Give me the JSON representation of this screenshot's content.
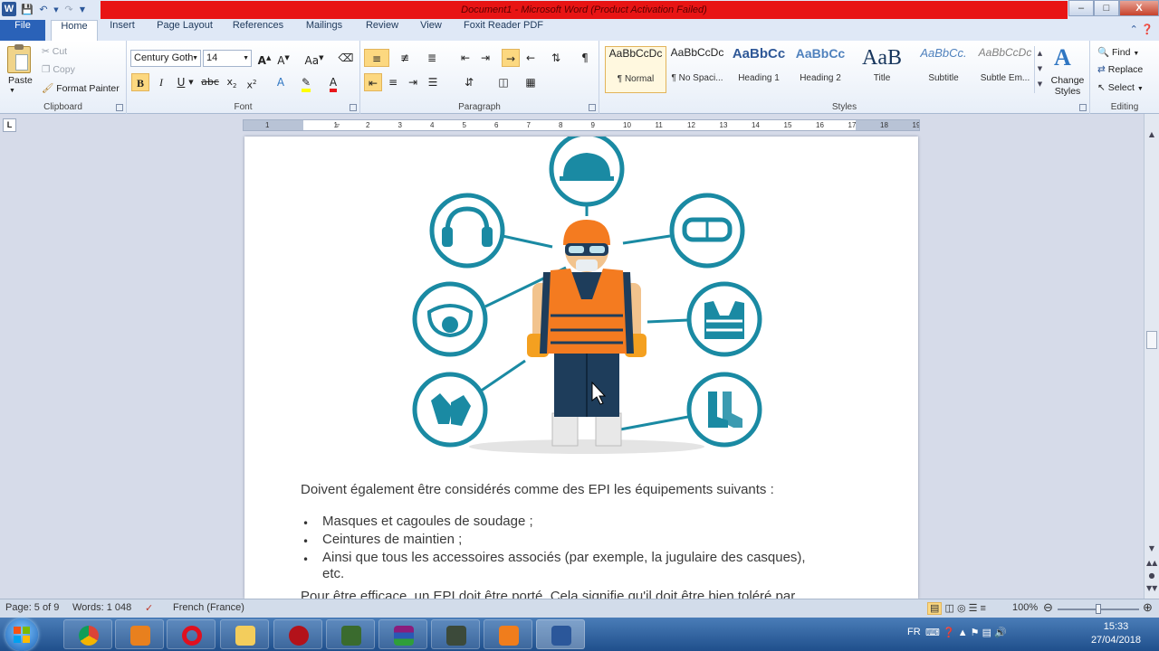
{
  "window": {
    "app_letter": "W",
    "title": "Document1  -  Microsoft Word (Product Activation Failed)",
    "min": "–",
    "max": "□",
    "close": "X"
  },
  "tabs": [
    "File",
    "Home",
    "Insert",
    "Page Layout",
    "References",
    "Mailings",
    "Review",
    "View",
    "Foxit Reader PDF"
  ],
  "clipboard": {
    "paste": "Paste",
    "cut": "Cut",
    "copy": "Copy",
    "format_painter": "Format Painter",
    "label": "Clipboard"
  },
  "font": {
    "name": "Century Goth",
    "size": "14",
    "label": "Font"
  },
  "paragraph": {
    "label": "Paragraph"
  },
  "styles": {
    "items": [
      {
        "preview": "AaBbCcDc",
        "name": "¶ Normal"
      },
      {
        "preview": "AaBbCcDc",
        "name": "¶ No Spaci..."
      },
      {
        "preview": "AaBbCc",
        "name": "Heading 1"
      },
      {
        "preview": "AaBbCc",
        "name": "Heading 2"
      },
      {
        "preview": "AaB",
        "name": "Title"
      },
      {
        "preview": "AaBbCc.",
        "name": "Subtitle"
      },
      {
        "preview": "AaBbCcDc",
        "name": "Subtle Em..."
      }
    ],
    "change_styles": "Change Styles",
    "label": "Styles"
  },
  "editing": {
    "find": "Find",
    "replace": "Replace",
    "select": "Select",
    "label": "Editing"
  },
  "ruler_numbers": [
    "1",
    "1",
    "2",
    "3",
    "4",
    "5",
    "6",
    "7",
    "8",
    "9",
    "10",
    "11",
    "12",
    "13",
    "14",
    "15",
    "16",
    "17",
    "18",
    "19"
  ],
  "document": {
    "intro": "Doivent également être considérés comme des EPI les équipements suivants :",
    "bullets": [
      "Masques et cagoules de soudage ;",
      "Ceintures de maintien ;",
      "Ainsi que tous les accessoires associés (par exemple, la jugulaire des casques),",
      "etc."
    ],
    "cut_line": "Pour être efficace, un EPI doit être porté. Cela signifie qu'il doit être bien toléré par"
  },
  "status": {
    "page": "Page: 5 of 9",
    "words": "Words: 1 048",
    "language": "French (France)",
    "zoom": "100%"
  },
  "taskbar": {
    "lang": "FR",
    "time": "15:33",
    "date": "27/04/2018"
  },
  "colors": {
    "accent": "#1a8aa3",
    "vest": "#f47b20",
    "title_bar_error": "#e81414",
    "file_tab": "#2a62b8"
  }
}
